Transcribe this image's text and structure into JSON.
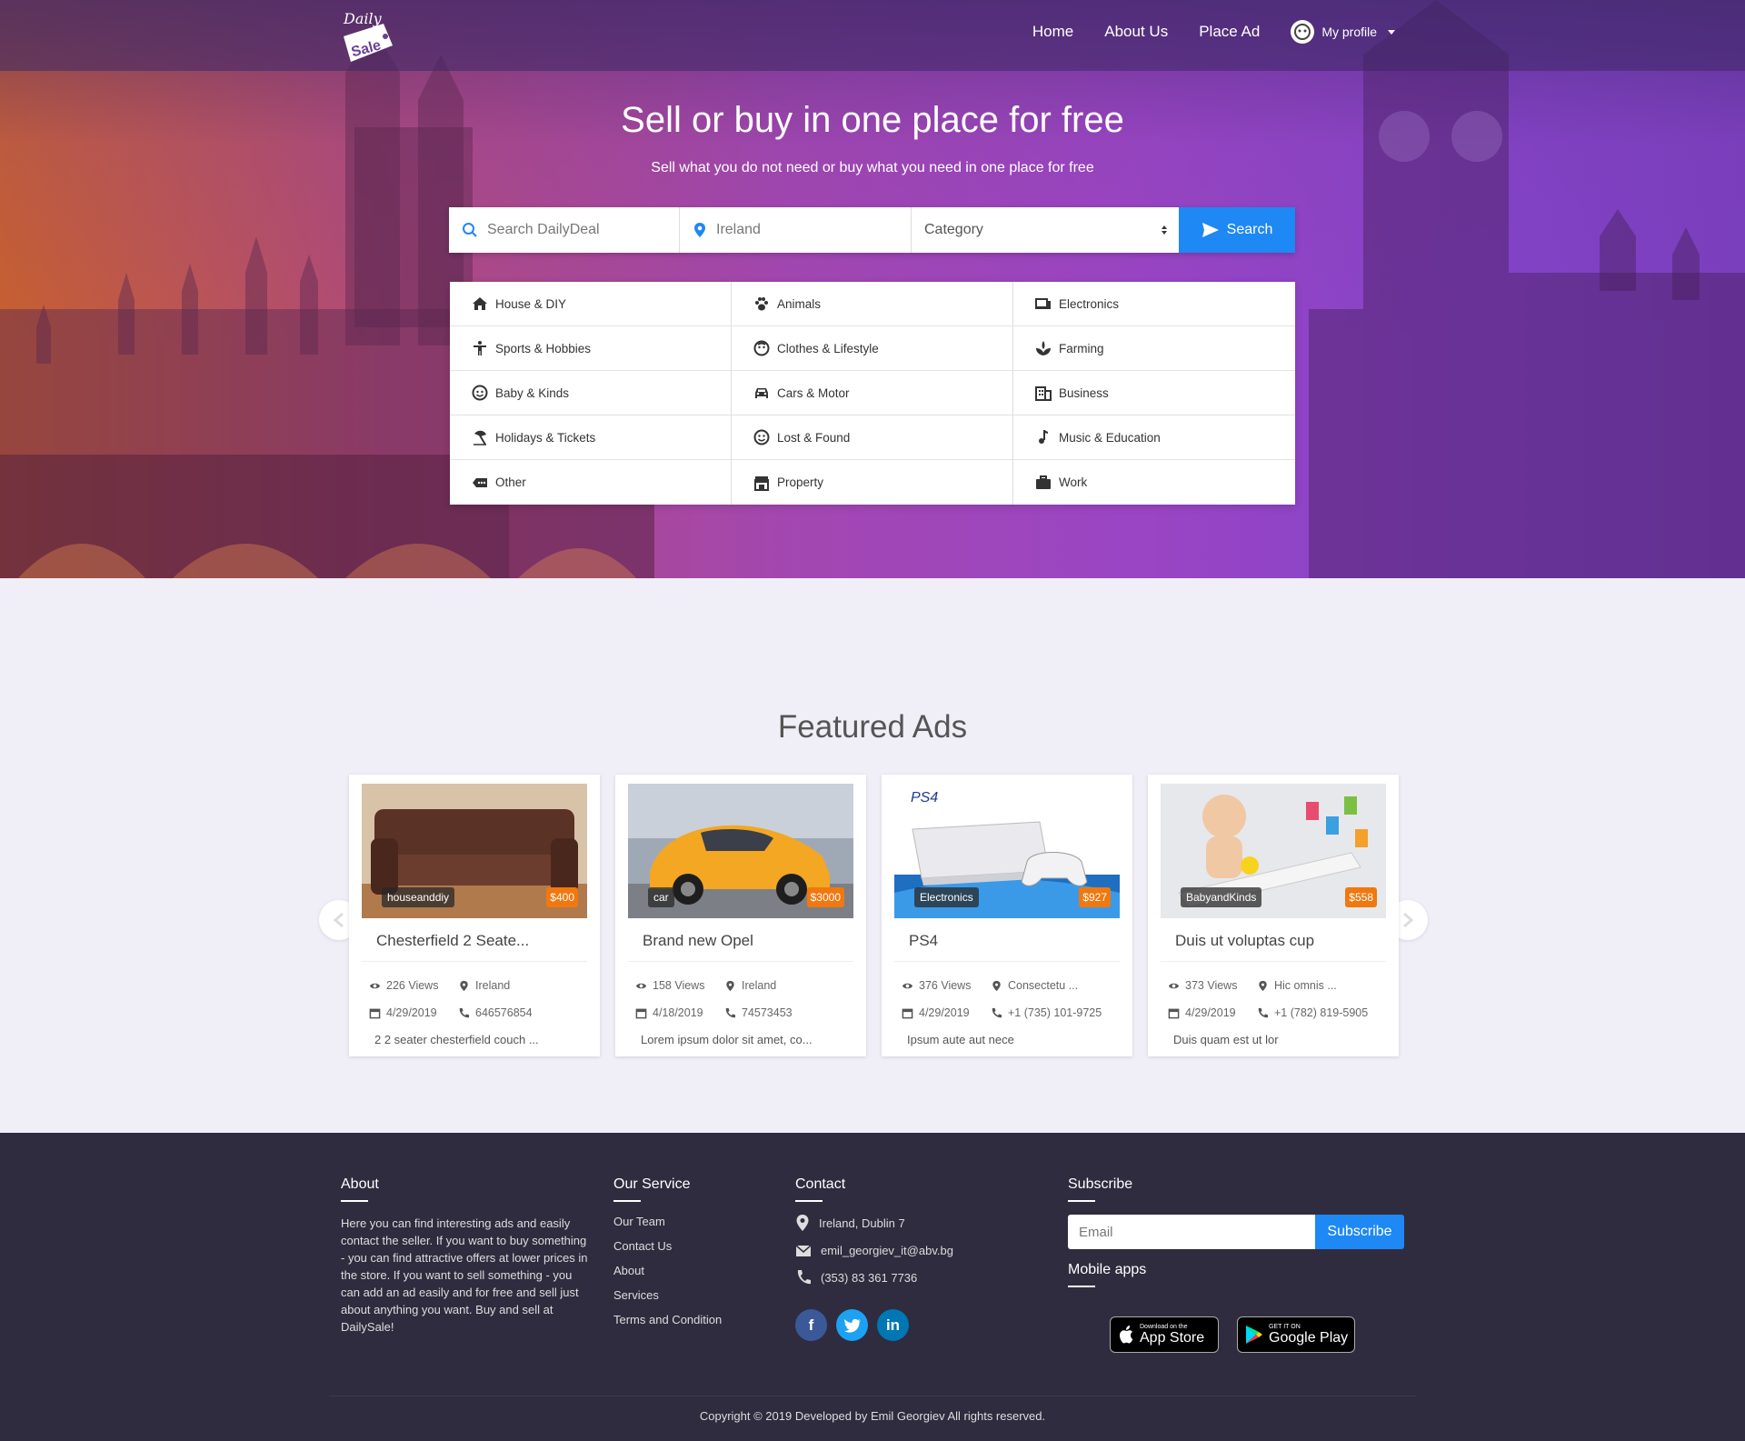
{
  "brand": {
    "logo_line1": "Daily",
    "logo_line2": "Sale"
  },
  "nav": {
    "home": "Home",
    "about": "About Us",
    "place_ad": "Place Ad",
    "profile": "My profile"
  },
  "hero": {
    "title": "Sell or buy in one place for free",
    "subtitle": "Sell what you do not need or buy what you need in one place for free"
  },
  "search": {
    "query_placeholder": "Search DailyDeal",
    "location_value": "Ireland",
    "category_value": "Category",
    "button": "Search"
  },
  "categories": [
    {
      "label": "House & DIY",
      "icon": "home-icon"
    },
    {
      "label": "Animals",
      "icon": "paw-icon"
    },
    {
      "label": "Electronics",
      "icon": "devices-icon"
    },
    {
      "label": "Sports & Hobbies",
      "icon": "person-icon"
    },
    {
      "label": "Clothes & Lifestyle",
      "icon": "face-icon"
    },
    {
      "label": "Farming",
      "icon": "plant-icon"
    },
    {
      "label": "Baby & Kinds",
      "icon": "baby-icon"
    },
    {
      "label": "Cars & Motor",
      "icon": "car-icon"
    },
    {
      "label": "Business",
      "icon": "building-icon"
    },
    {
      "label": "Holidays & Tickets",
      "icon": "beach-icon"
    },
    {
      "label": "Lost & Found",
      "icon": "smile-icon"
    },
    {
      "label": "Music & Education",
      "icon": "music-note-icon"
    },
    {
      "label": "Other",
      "icon": "more-icon"
    },
    {
      "label": "Property",
      "icon": "store-icon"
    },
    {
      "label": "Work",
      "icon": "briefcase-icon"
    }
  ],
  "featured": {
    "title": "Featured Ads",
    "ads": [
      {
        "category": "houseanddiy",
        "price": "$400",
        "title": "Chesterfield 2 Seate...",
        "views": "226 Views",
        "location": "Ireland",
        "date": "4/29/2019",
        "phone": "646576854",
        "description": "2 2 seater chesterfield couch ..."
      },
      {
        "category": "car",
        "price": "$3000",
        "title": "Brand new Opel",
        "views": "158 Views",
        "location": "Ireland",
        "date": "4/18/2019",
        "phone": "74573453",
        "description": "Lorem ipsum dolor sit amet, co..."
      },
      {
        "category": "Electronics",
        "price": "$927",
        "title": "PS4",
        "views": "376 Views",
        "location": "Consectetu ...",
        "date": "4/29/2019",
        "phone": "+1 (735) 101-9725",
        "description": "Ipsum aute aut nece"
      },
      {
        "category": "BabyandKinds",
        "price": "$558",
        "title": "Duis ut voluptas cup",
        "views": "373 Views",
        "location": "Hic omnis ...",
        "date": "4/29/2019",
        "phone": "+1 (782) 819-5905",
        "description": "Duis quam est ut lor"
      }
    ]
  },
  "footer": {
    "about_title": "About",
    "about_text": "Here you can find interesting ads and easily contact the seller. If you want to buy something - you can find attractive offers at lower prices in the store. If you want to sell something - you can add an ad easily and for free and sell just about anything you want. Buy and sell at DailySale!",
    "service_title": "Our Service",
    "service_links": [
      "Our Team",
      "Contact Us",
      "About",
      "Services",
      "Terms and Condition"
    ],
    "contact_title": "Contact",
    "address": "Ireland, Dublin 7",
    "email": "emil_georgiev_it@abv.bg",
    "phone": "(353) 83 361 7736",
    "social": {
      "facebook": "f",
      "linkedin": "in"
    },
    "subscribe_title": "Subscribe",
    "email_placeholder": "Email",
    "subscribe_button": "Subscribe",
    "mobile_title": "Mobile apps",
    "appstore_small": "Download on the",
    "appstore_big": "App Store",
    "googleplay_small": "GET IT ON",
    "googleplay_big": "Google Play",
    "copyright": "Copyright © 2019 Developed by Emil Georgiev All rights reserved."
  },
  "colors": {
    "accent": "#1e88f5",
    "price": "#f0780f",
    "footer": "#2f2c3f"
  }
}
